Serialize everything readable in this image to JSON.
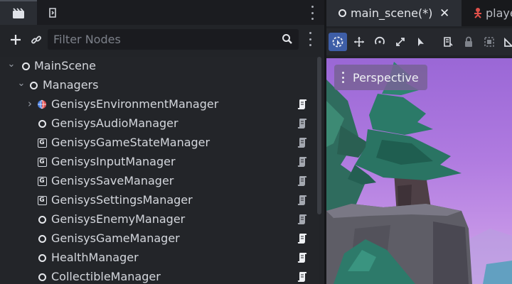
{
  "scene_dock": {
    "filter_placeholder": "Filter Nodes"
  },
  "tree": [
    {
      "name": "MainScene",
      "icon": "node3d-ring-icon",
      "expanded": true,
      "has_arrow": true,
      "has_script": false
    },
    {
      "name": "Managers",
      "icon": "node3d-ring-icon",
      "expanded": true,
      "has_arrow": true,
      "has_script": false
    },
    {
      "name": "GenisysEnvironmentManager",
      "icon": "world-environment-icon",
      "expanded": false,
      "has_arrow": true,
      "has_script": true
    },
    {
      "name": "GenisysAudioManager",
      "icon": "node3d-ring-icon",
      "expanded": false,
      "has_arrow": false,
      "has_script": true
    },
    {
      "name": "GenisysGameStateManager",
      "icon": "genisys-g-icon",
      "expanded": false,
      "has_arrow": false,
      "has_script": true
    },
    {
      "name": "GenisysInputManager",
      "icon": "genisys-g-icon",
      "expanded": false,
      "has_arrow": false,
      "has_script": true
    },
    {
      "name": "GenisysSaveManager",
      "icon": "genisys-g-icon",
      "expanded": false,
      "has_arrow": false,
      "has_script": true
    },
    {
      "name": "GenisysSettingsManager",
      "icon": "genisys-g-icon",
      "expanded": false,
      "has_arrow": false,
      "has_script": true
    },
    {
      "name": "GenisysEnemyManager",
      "icon": "node3d-ring-icon",
      "expanded": false,
      "has_arrow": false,
      "has_script": true
    },
    {
      "name": "GenisysGameManager",
      "icon": "node3d-ring-icon",
      "expanded": false,
      "has_arrow": false,
      "has_script": true
    },
    {
      "name": "HealthManager",
      "icon": "node3d-ring-icon",
      "expanded": false,
      "has_arrow": false,
      "has_script": true
    },
    {
      "name": "CollectibleManager",
      "icon": "node3d-ring-icon",
      "expanded": false,
      "has_arrow": false,
      "has_script": true
    }
  ],
  "editor": {
    "tabs": [
      {
        "label": "main_scene(*)",
        "active": true
      },
      {
        "label": "playe",
        "active": false
      }
    ],
    "viewport_label": "Perspective"
  },
  "colors": {
    "accent": "#3e5ea7",
    "player_tab_icon": "#e0504a",
    "environment_icon_a": "#e05050",
    "environment_icon_b": "#4a7fe0",
    "sky_top": "#9a67d6",
    "tree_foliage": "#2d7a6a"
  }
}
